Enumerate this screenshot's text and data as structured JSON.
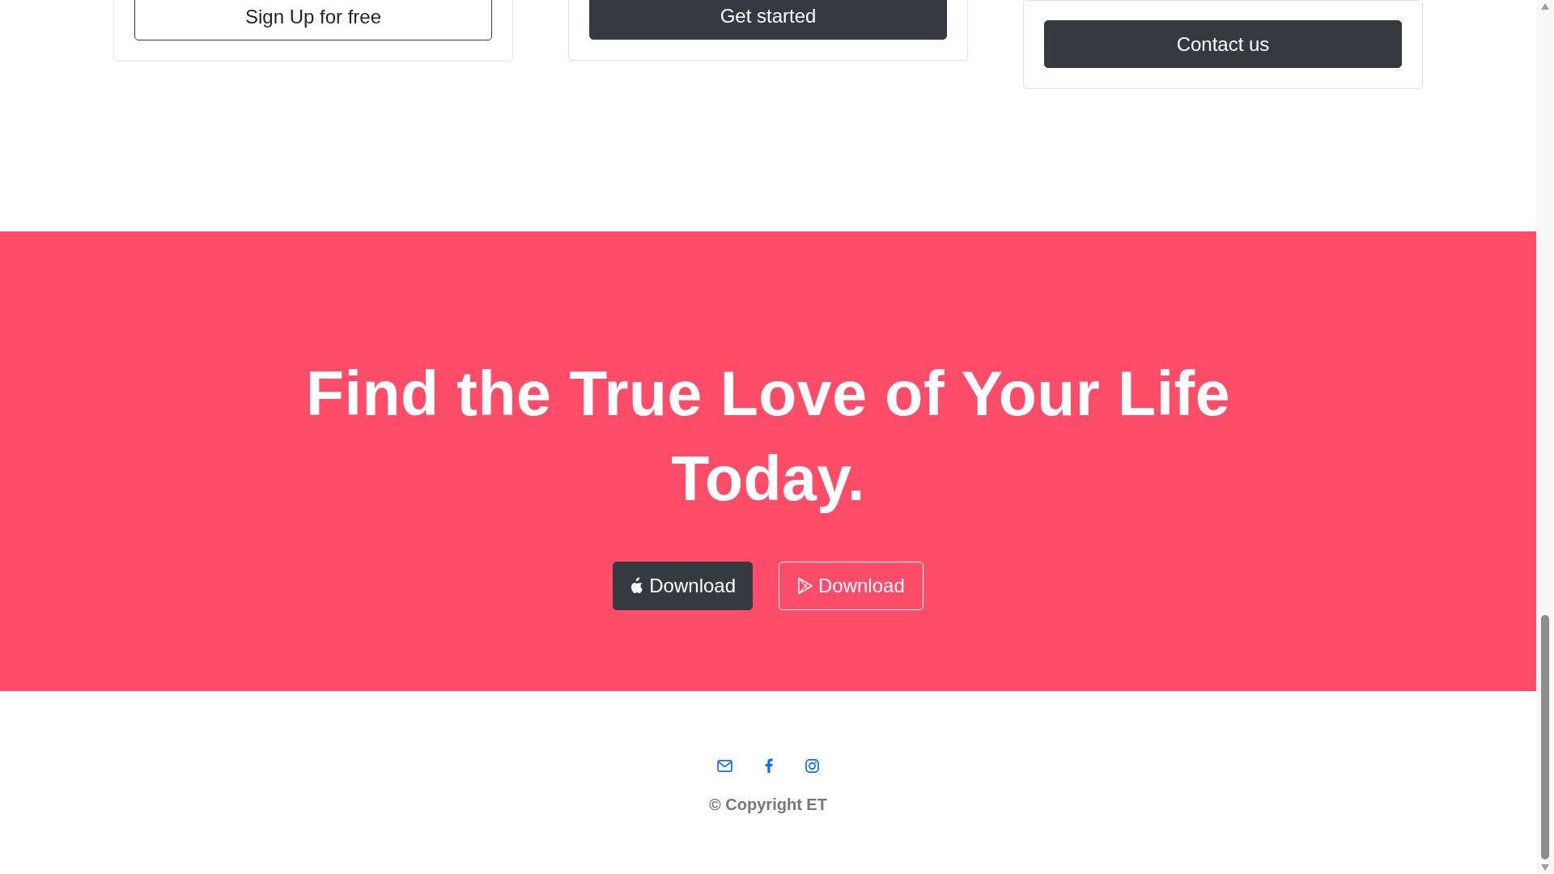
{
  "pricing_cards": [
    {
      "button": {
        "label": "Sign Up for free",
        "kind": "outline"
      }
    },
    {
      "button": {
        "label": "Get started",
        "kind": "dark"
      }
    },
    {
      "button": {
        "label": "Contact us",
        "kind": "dark"
      }
    }
  ],
  "cta": {
    "heading": "Find the True Love of Your Life Today.",
    "buttons": [
      {
        "label": "Download",
        "kind": "apple"
      },
      {
        "label": "Download",
        "kind": "play"
      }
    ]
  },
  "footer": {
    "social_links": [
      {
        "kind": "email"
      },
      {
        "kind": "facebook"
      },
      {
        "kind": "instagram"
      }
    ],
    "copyright": "© Copyright ET"
  }
}
